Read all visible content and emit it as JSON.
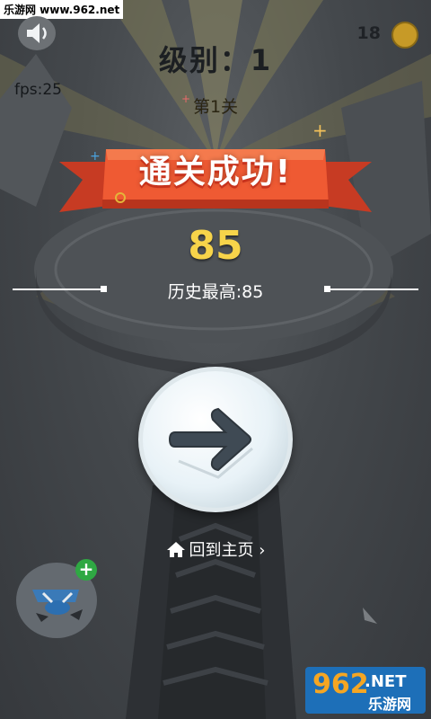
{
  "watermark_top": "乐游网 www.962.net",
  "fps": "fps:25",
  "coins": "18",
  "level": "级别：1",
  "stage": "第1关",
  "banner": "通关成功!",
  "score": "85",
  "best": "历史最高:85",
  "home_link": "回到主页",
  "home_chevron": "›",
  "plus_badge": "+",
  "watermark_bottom": {
    "number": "962",
    "net": ".NET",
    "cn": "乐游网"
  },
  "colors": {
    "banner": "#e8502e",
    "score": "#f7d44a",
    "arrow": "#3f4a54",
    "plus": "#2fa843"
  },
  "icons": {
    "speaker": "speaker-icon",
    "coin": "coin-icon",
    "home": "home-icon",
    "arrow": "arrow-right-icon"
  }
}
